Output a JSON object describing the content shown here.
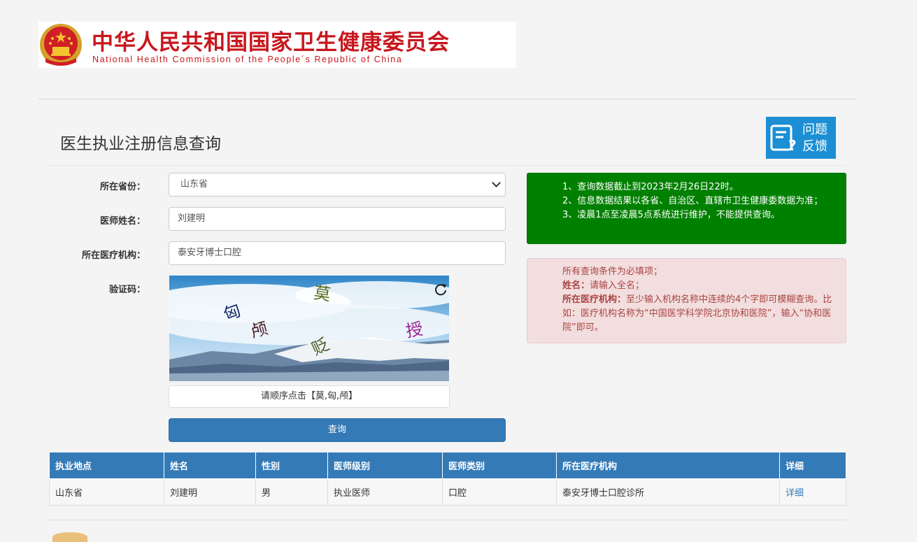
{
  "header": {
    "title_zh": "中华人民共和国国家卫生健康委员会",
    "title_en": "National Health Commission of the People´s Republic of China"
  },
  "page": {
    "title": "医生执业注册信息查询",
    "feedback": {
      "line1": "问题",
      "line2": "反馈"
    }
  },
  "form": {
    "province_label": "所在省份：",
    "province_value": "山东省",
    "name_label": "医师姓名：",
    "name_value": "刘建明",
    "org_label": "所在医疗机构：",
    "org_value": "泰安牙博士口腔",
    "captcha_label": "验证码：",
    "captcha_chars": [
      "匈",
      "颅",
      "莫",
      "贬",
      "授"
    ],
    "captcha_hint": "请顺序点击【莫,匈,颅】",
    "submit_label": "查询"
  },
  "notice": {
    "lines": [
      "1、查询数据截止到2023年2月26日22时。",
      "2、信息数据结果以各省、自治区、直辖市卫生健康委数据为准；",
      "3、凌晨1点至凌晨5点系统进行维护，不能提供查询。"
    ]
  },
  "rules": {
    "line1": "所有查询条件为必填项；",
    "name_key": "姓名：",
    "name_text": "请输入全名；",
    "org_key": "所在医疗机构：",
    "org_text": "至少输入机构名称中连续的4个字即可模糊查询。比如：医疗机构名称为“中国医学科学院北京协和医院”，输入“协和医院”即可。"
  },
  "table": {
    "headers": [
      "执业地点",
      "姓名",
      "性别",
      "医师级别",
      "医师类别",
      "所在医疗机构",
      "详细"
    ],
    "rows": [
      [
        "山东省",
        "刘建明",
        "男",
        "执业医师",
        "口腔",
        "泰安牙博士口腔诊所",
        "详细"
      ]
    ]
  },
  "colors": {
    "brand_red": "#c8161d",
    "primary_blue": "#337ab7",
    "notice_green": "#008000",
    "alert_pink": "#f2dede"
  }
}
